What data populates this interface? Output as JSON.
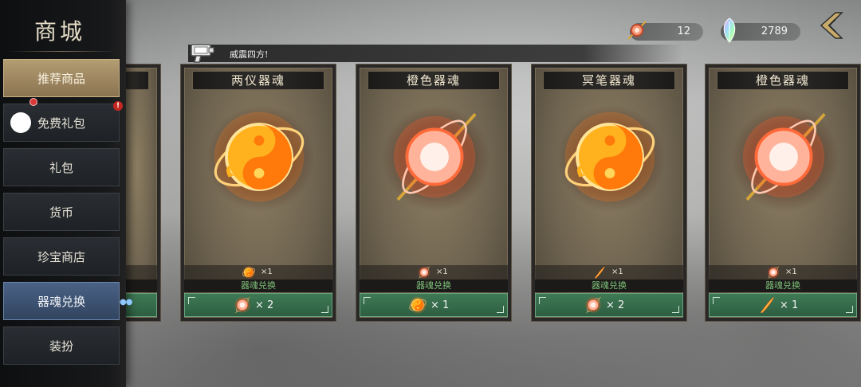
{
  "sidebar": {
    "title": "商城",
    "items": [
      {
        "label": "推荐商品"
      },
      {
        "label": "免费礼包"
      },
      {
        "label": "礼包"
      },
      {
        "label": "货币"
      },
      {
        "label": "珍宝商店"
      },
      {
        "label": "器魂兑换"
      },
      {
        "label": "装扮"
      }
    ],
    "badge": "!"
  },
  "currencies": [
    {
      "icon": "soul-orb-icon",
      "value": "12"
    },
    {
      "icon": "crystal-feather-icon",
      "value": "2789"
    }
  ],
  "announcement": "威震四方!",
  "cards": [
    {
      "title": "两仪器魂",
      "art": "yin-yang-soul",
      "req_icon": "yin-yang-soul-icon",
      "req_qty": "×1",
      "cta_label": "器魂兑换",
      "cost_icon": "orange-soul-orb-icon",
      "cost": "× 2"
    },
    {
      "title": "橙色器魂",
      "art": "orange-orb-soul",
      "req_icon": "orange-soul-orb-icon",
      "req_qty": "×1",
      "cta_label": "器魂兑换",
      "cost_icon": "yin-yang-soul-icon",
      "cost": "× 1"
    },
    {
      "title": "冥笔器魂",
      "art": "yin-yang-soul",
      "req_icon": "flame-feather-icon",
      "req_qty": "×1",
      "cta_label": "器魂兑换",
      "cost_icon": "orange-soul-orb-icon",
      "cost": "× 2"
    },
    {
      "title": "橙色器魂",
      "art": "orange-orb-soul",
      "req_icon": "orange-soul-orb-icon",
      "req_qty": "×1",
      "cta_label": "器魂兑换",
      "cost_icon": "flame-feather-icon",
      "cost": "× 1"
    }
  ],
  "colors": {
    "accent_gold": "#b39d73",
    "active_blue": "#4a6286",
    "cta_green": "#3f7a55",
    "cta_label_green": "#7fc07a"
  }
}
